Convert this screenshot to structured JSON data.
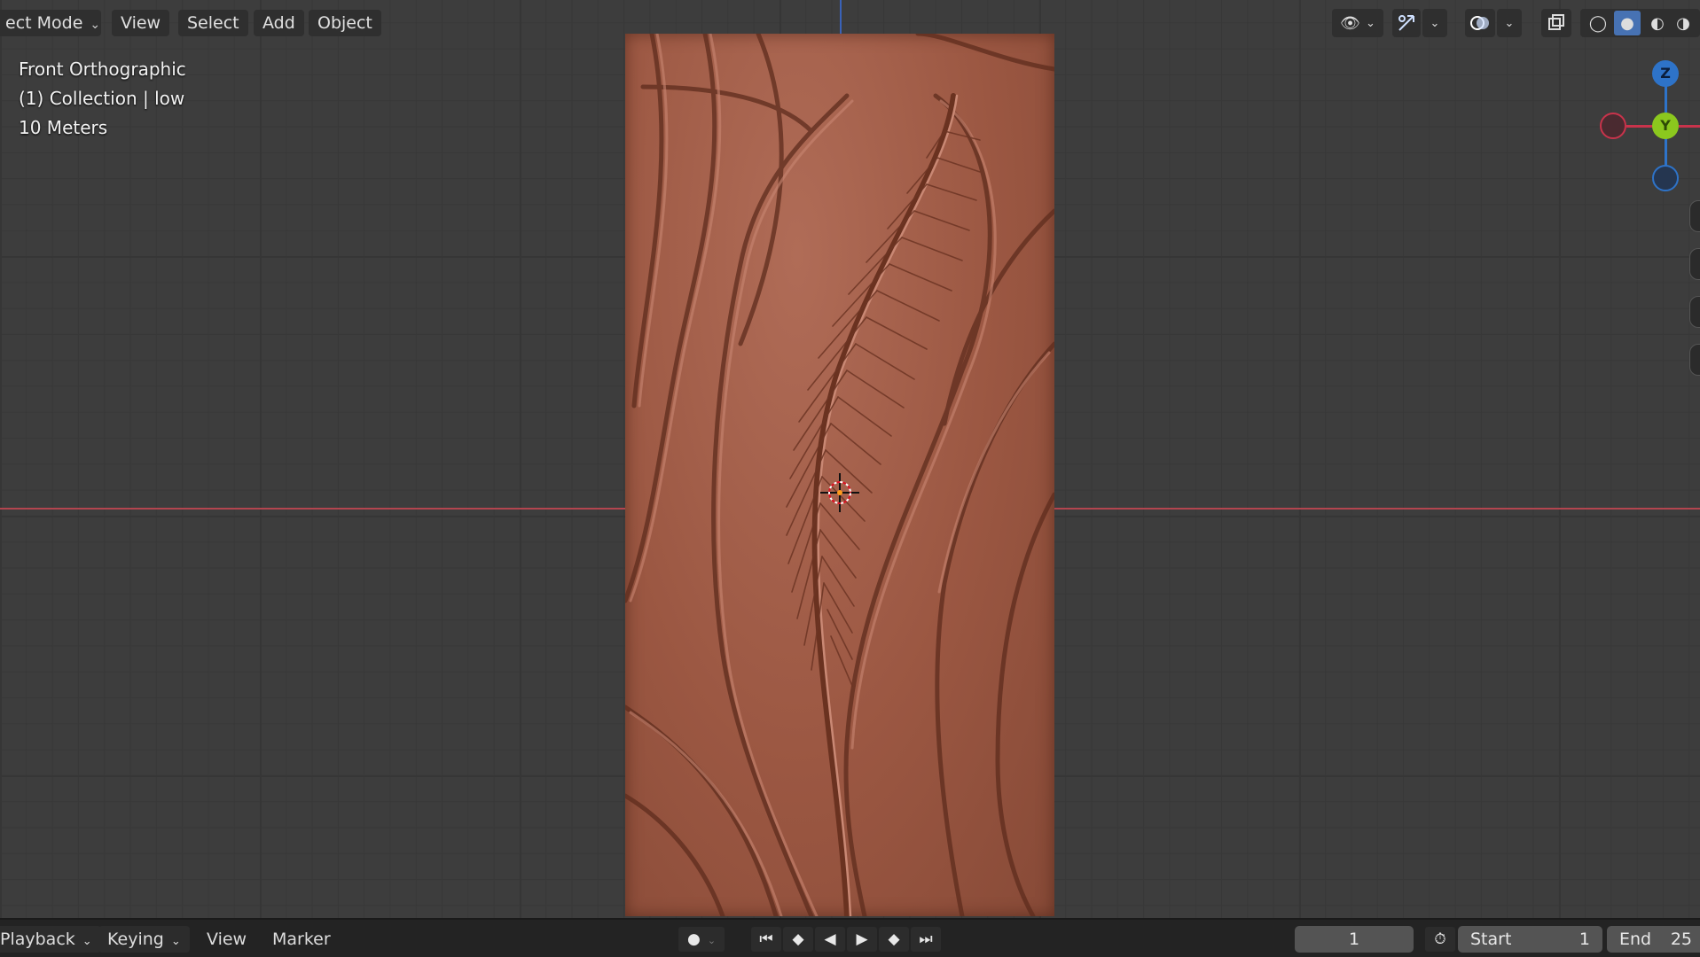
{
  "header": {
    "mode_label": "ect Mode",
    "menus": [
      "View",
      "Select",
      "Add",
      "Object"
    ]
  },
  "overlay": {
    "view_name": "Front Orthographic",
    "collection": "(1) Collection | low",
    "scale": "10 Meters"
  },
  "gizmo": {
    "z_label": "Z",
    "y_label": "Y"
  },
  "timeline": {
    "playback_label": "Playback",
    "keying_label": "Keying",
    "view_label": "View",
    "marker_label": "Marker",
    "current_frame": "1",
    "start_label": "Start",
    "start_value": "1",
    "end_label": "End",
    "end_value": "25"
  },
  "colors": {
    "axis_x": "#b3454f",
    "axis_z": "#3a62b8",
    "gizmo_z": "#2e73c8",
    "gizmo_y": "#8bc81e",
    "gizmo_x": "#c8334b",
    "panel": "#9b5742",
    "accent": "#4772b3"
  }
}
